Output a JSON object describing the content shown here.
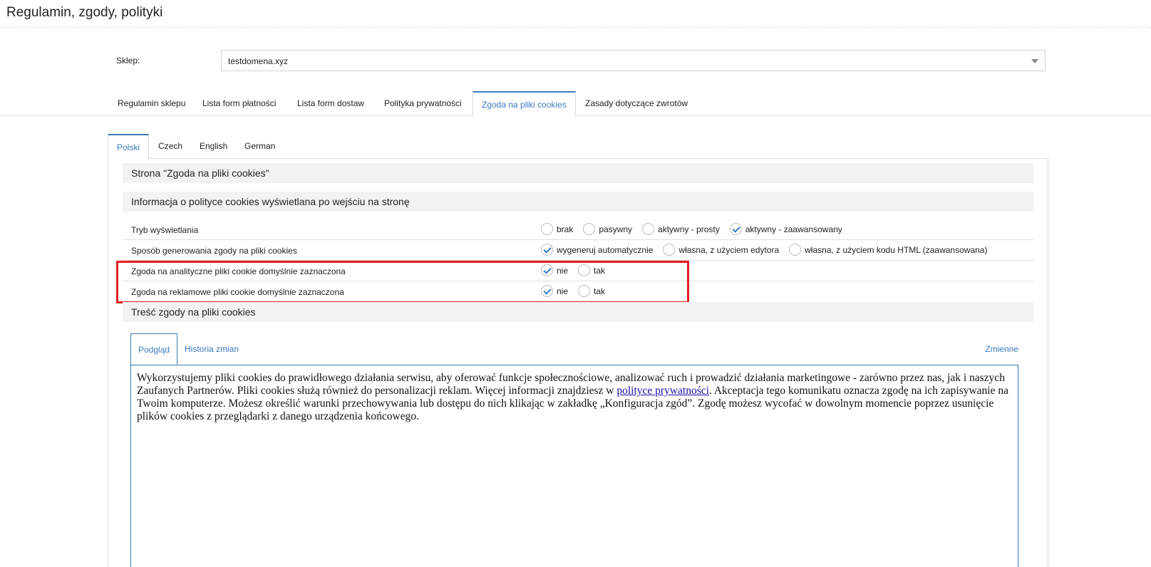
{
  "header": {
    "title": "Regulamin, zgody, polityki"
  },
  "shop": {
    "label": "Sklep:",
    "value": "testdomena.xyz"
  },
  "main_tabs": [
    {
      "label": "Regulamin sklepu",
      "active": false
    },
    {
      "label": "Lista form płatności",
      "active": false
    },
    {
      "label": "Lista form dostaw",
      "active": false
    },
    {
      "label": "Polityka prywatności",
      "active": false
    },
    {
      "label": "Zgoda na pliki cookies",
      "active": true
    },
    {
      "label": "Zasady dotyczące zwrotów",
      "active": false
    }
  ],
  "lang_tabs": [
    {
      "label": "Polski",
      "active": true
    },
    {
      "label": "Czech",
      "active": false
    },
    {
      "label": "English",
      "active": false
    },
    {
      "label": "German",
      "active": false
    }
  ],
  "sections": {
    "page": "Strona \"Zgoda na pliki cookies\"",
    "info": "Informacja o polityce cookies wyświetlana po wejściu na stronę",
    "content": "Treść zgody na pliki cookies"
  },
  "rows": [
    {
      "label": "Tryb wyświetlania",
      "options": [
        {
          "label": "brak",
          "checked": false
        },
        {
          "label": "pasywny",
          "checked": false
        },
        {
          "label": "aktywny - prosty",
          "checked": false
        },
        {
          "label": "aktywny - zaawansowany",
          "checked": true
        }
      ]
    },
    {
      "label": "Sposób generowania zgody na pliki cookies",
      "options": [
        {
          "label": "wygeneruj automatycznie",
          "checked": true
        },
        {
          "label": "własna, z użyciem edytora",
          "checked": false
        },
        {
          "label": "własna, z użyciem kodu HTML (zaawansowana)",
          "checked": false
        }
      ]
    },
    {
      "label": "Zgoda na analityczne pliki cookie domyślnie zaznaczona",
      "options": [
        {
          "label": "nie",
          "checked": true
        },
        {
          "label": "tak",
          "checked": false
        }
      ]
    },
    {
      "label": "Zgoda na reklamowe pliki cookie domyślnie zaznaczona",
      "options": [
        {
          "label": "nie",
          "checked": true
        },
        {
          "label": "tak",
          "checked": false
        }
      ]
    }
  ],
  "editor": {
    "tabs": [
      {
        "label": "Podgląd",
        "active": true
      },
      {
        "label": "Historia zmian",
        "active": false
      }
    ],
    "variables_label": "Zmienne",
    "text_before_link": "Wykorzystujemy pliki cookies do prawidłowego działania serwisu, aby oferować funkcje społecznościowe, analizować ruch i prowadzić działania marketingowe - zarówno przez nas, jak i naszych Zaufanych Partnerów. Pliki cookies służą również do personalizacji reklam. Więcej informacji znajdziesz w ",
    "link_text": "polityce prywatności",
    "text_after_link": ". Akceptacja tego komunikatu oznacza zgodę na ich zapisywanie na Twoim komputerze. Możesz określić warunki przechowywania lub dostępu do nich klikając w zakładkę „Konfiguracja zgód”. Zgodę możesz wycofać w dowolnym momencie poprzez usunięcie plików cookies z przeglądarki z danego urządzenia końcowego."
  },
  "colors": {
    "accent": "#3b7bbf",
    "highlight": "#e31e24"
  }
}
